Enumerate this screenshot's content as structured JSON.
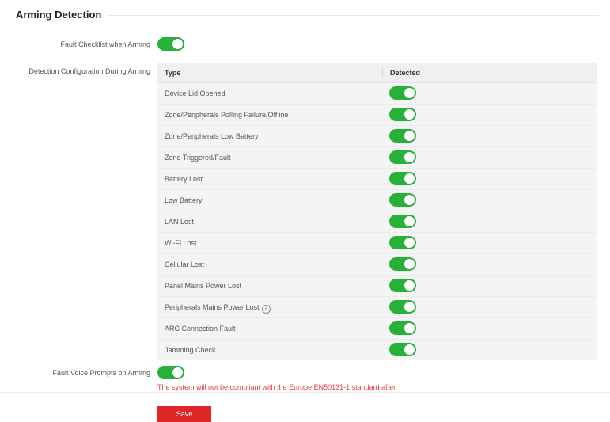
{
  "section": {
    "title": "Arming Detection"
  },
  "fault_checklist": {
    "label": "Fault Checklist when Arming",
    "enabled": true
  },
  "detection_config": {
    "label": "Detection Configuration During Arming",
    "columns": [
      "Type",
      "Detected"
    ],
    "rows": [
      {
        "type": "Device Lid Opened",
        "detected": true
      },
      {
        "type": "Zone/Peripherals Polling Failure/Offline",
        "detected": true
      },
      {
        "type": "Zone/Peripherals Low Battery",
        "detected": true
      },
      {
        "type": "Zone Triggered/Fault",
        "detected": true
      },
      {
        "type": "Battery Lost",
        "detected": true
      },
      {
        "type": "Low Battery",
        "detected": true
      },
      {
        "type": "LAN Lost",
        "detected": true
      },
      {
        "type": "Wi-Fi Lost",
        "detected": true
      },
      {
        "type": "Cellular Lost",
        "detected": true
      },
      {
        "type": "Panel Mains Power Lost",
        "detected": true
      },
      {
        "type": "Peripherals Mains Power Lost",
        "detected": true,
        "info_icon": "info-icon"
      },
      {
        "type": "ARC Connection Fault",
        "detected": true
      },
      {
        "type": "Jamming Check",
        "detected": true
      }
    ]
  },
  "voice_prompts": {
    "label": "Fault Voice Prompts on Arming",
    "enabled": true,
    "warning": "The system will not be compliant with the Europe EN50131-1 standard after"
  },
  "actions": {
    "save_label": "Save"
  },
  "colors": {
    "toggle_on": "#27b03a",
    "save_button": "#e02727",
    "warning_text": "#e83b3b"
  }
}
